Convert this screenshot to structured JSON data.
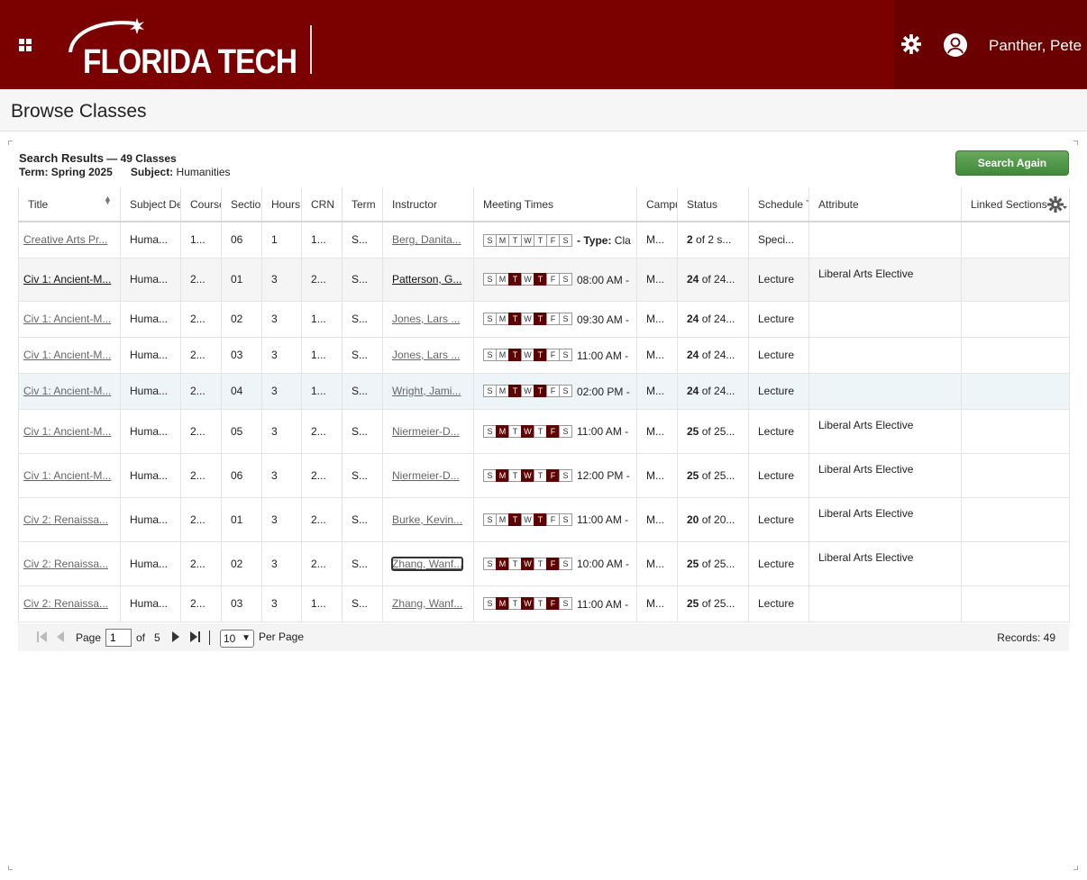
{
  "header": {
    "logo_text": "FLORIDA TECH",
    "user_name": "Panther, Pete",
    "brand_color": "#7b0000",
    "icons": [
      "grid-icon",
      "gear-icon",
      "user-icon"
    ]
  },
  "page": {
    "title": "Browse Classes"
  },
  "summary": {
    "label": "Search Results",
    "count": "— 49 Classes",
    "term_label": "Term:",
    "term_value": "Spring 2025",
    "subject_label": "Subject:",
    "subject_value": "Humanities"
  },
  "search_again_label": "Search Again",
  "columns": [
    "Title",
    "Subject Description",
    "Course Number",
    "Section",
    "Hours",
    "CRN",
    "Term",
    "Instructor",
    "Meeting Times",
    "Campus",
    "Status",
    "Schedule Type",
    "Attribute",
    "Linked Sections"
  ],
  "day_letters": [
    "S",
    "M",
    "T",
    "W",
    "T",
    "F",
    "S"
  ],
  "rows": [
    {
      "title": "Creative Arts Pr...",
      "subject": "Huma...",
      "course": "1...",
      "section": "06",
      "hours": "1",
      "crn": "1...",
      "term": "S...",
      "instructor": "Berg, Danita...",
      "days": [
        0,
        0,
        0,
        0,
        0,
        0,
        0
      ],
      "time": "",
      "type_label": "- Type:",
      "type_value": "Cla",
      "campus": "M...",
      "status_num": "2",
      "status_rest": " of 2 s...",
      "schedule": "Speci...",
      "attribute": "",
      "linked": ""
    },
    {
      "title": "Civ 1: Ancient-M...",
      "subject": "Huma...",
      "course": "2...",
      "section": "01",
      "hours": "3",
      "crn": "2...",
      "term": "S...",
      "instructor": "Patterson, G...",
      "days": [
        0,
        0,
        1,
        0,
        1,
        0,
        0
      ],
      "time": "08:00 AM -",
      "campus": "M...",
      "status_num": "24",
      "status_rest": " of 24...",
      "schedule": "Lecture",
      "attribute": "Liberal Arts Elective",
      "linked": ""
    },
    {
      "title": "Civ 1: Ancient-M...",
      "subject": "Huma...",
      "course": "2...",
      "section": "02",
      "hours": "3",
      "crn": "1...",
      "term": "S...",
      "instructor": "Jones, Lars ...",
      "days": [
        0,
        0,
        1,
        0,
        1,
        0,
        0
      ],
      "time": "09:30 AM -",
      "campus": "M...",
      "status_num": "24",
      "status_rest": " of 24...",
      "schedule": "Lecture",
      "attribute": "",
      "linked": ""
    },
    {
      "title": "Civ 1: Ancient-M...",
      "subject": "Huma...",
      "course": "2...",
      "section": "03",
      "hours": "3",
      "crn": "1...",
      "term": "S...",
      "instructor": "Jones, Lars ...",
      "days": [
        0,
        0,
        1,
        0,
        1,
        0,
        0
      ],
      "time": "11:00 AM -",
      "campus": "M...",
      "status_num": "24",
      "status_rest": " of 24...",
      "schedule": "Lecture",
      "attribute": "",
      "linked": ""
    },
    {
      "title": "Civ 1: Ancient-M...",
      "subject": "Huma...",
      "course": "2...",
      "section": "04",
      "hours": "3",
      "crn": "1...",
      "term": "S...",
      "instructor": "Wright, Jami...",
      "days": [
        0,
        0,
        1,
        0,
        1,
        0,
        0
      ],
      "time": "02:00 PM -",
      "campus": "M...",
      "status_num": "24",
      "status_rest": " of 24...",
      "schedule": "Lecture",
      "attribute": "",
      "linked": ""
    },
    {
      "title": "Civ 1: Ancient-M...",
      "subject": "Huma...",
      "course": "2...",
      "section": "05",
      "hours": "3",
      "crn": "2...",
      "term": "S...",
      "instructor": "Niermeier-D...",
      "days": [
        0,
        1,
        0,
        1,
        0,
        1,
        0
      ],
      "time": "11:00 AM -",
      "campus": "M...",
      "status_num": "25",
      "status_rest": " of 25...",
      "schedule": "Lecture",
      "attribute": "Liberal Arts Elective",
      "linked": ""
    },
    {
      "title": "Civ 1: Ancient-M...",
      "subject": "Huma...",
      "course": "2...",
      "section": "06",
      "hours": "3",
      "crn": "2...",
      "term": "S...",
      "instructor": "Niermeier-D...",
      "days": [
        0,
        1,
        0,
        1,
        0,
        1,
        0
      ],
      "time": "12:00 PM -",
      "campus": "M...",
      "status_num": "25",
      "status_rest": " of 25...",
      "schedule": "Lecture",
      "attribute": "Liberal Arts Elective",
      "linked": ""
    },
    {
      "title": "Civ 2: Renaissa...",
      "subject": "Huma...",
      "course": "2...",
      "section": "01",
      "hours": "3",
      "crn": "2...",
      "term": "S...",
      "instructor": "Burke, Kevin...",
      "days": [
        0,
        0,
        1,
        0,
        1,
        0,
        0
      ],
      "time": "11:00 AM -",
      "campus": "M...",
      "status_num": "20",
      "status_rest": " of 20...",
      "schedule": "Lecture",
      "attribute": "Liberal Arts Elective",
      "linked": ""
    },
    {
      "title": "Civ 2: Renaissa...",
      "subject": "Huma...",
      "course": "2...",
      "section": "02",
      "hours": "3",
      "crn": "2...",
      "term": "S...",
      "instructor": "Zhang, Wanf...",
      "days": [
        0,
        1,
        0,
        1,
        0,
        1,
        0
      ],
      "time": "10:00 AM -",
      "campus": "M...",
      "status_num": "25",
      "status_rest": " of 25...",
      "schedule": "Lecture",
      "attribute": "Liberal Arts Elective",
      "linked": ""
    },
    {
      "title": "Civ 2: Renaissa...",
      "subject": "Huma...",
      "course": "2...",
      "section": "03",
      "hours": "3",
      "crn": "1...",
      "term": "S...",
      "instructor": "Zhang, Wanf...",
      "days": [
        0,
        1,
        0,
        1,
        0,
        1,
        0
      ],
      "time": "11:00 AM -",
      "campus": "M...",
      "status_num": "25",
      "status_rest": " of 25...",
      "schedule": "Lecture",
      "attribute": "",
      "linked": ""
    }
  ],
  "pager": {
    "page_label": "Page",
    "current_page": "1",
    "of_label": "of",
    "total_pages": "5",
    "per_page_value": "10",
    "per_page_label": "Per Page",
    "records_label": "Records: 49"
  }
}
